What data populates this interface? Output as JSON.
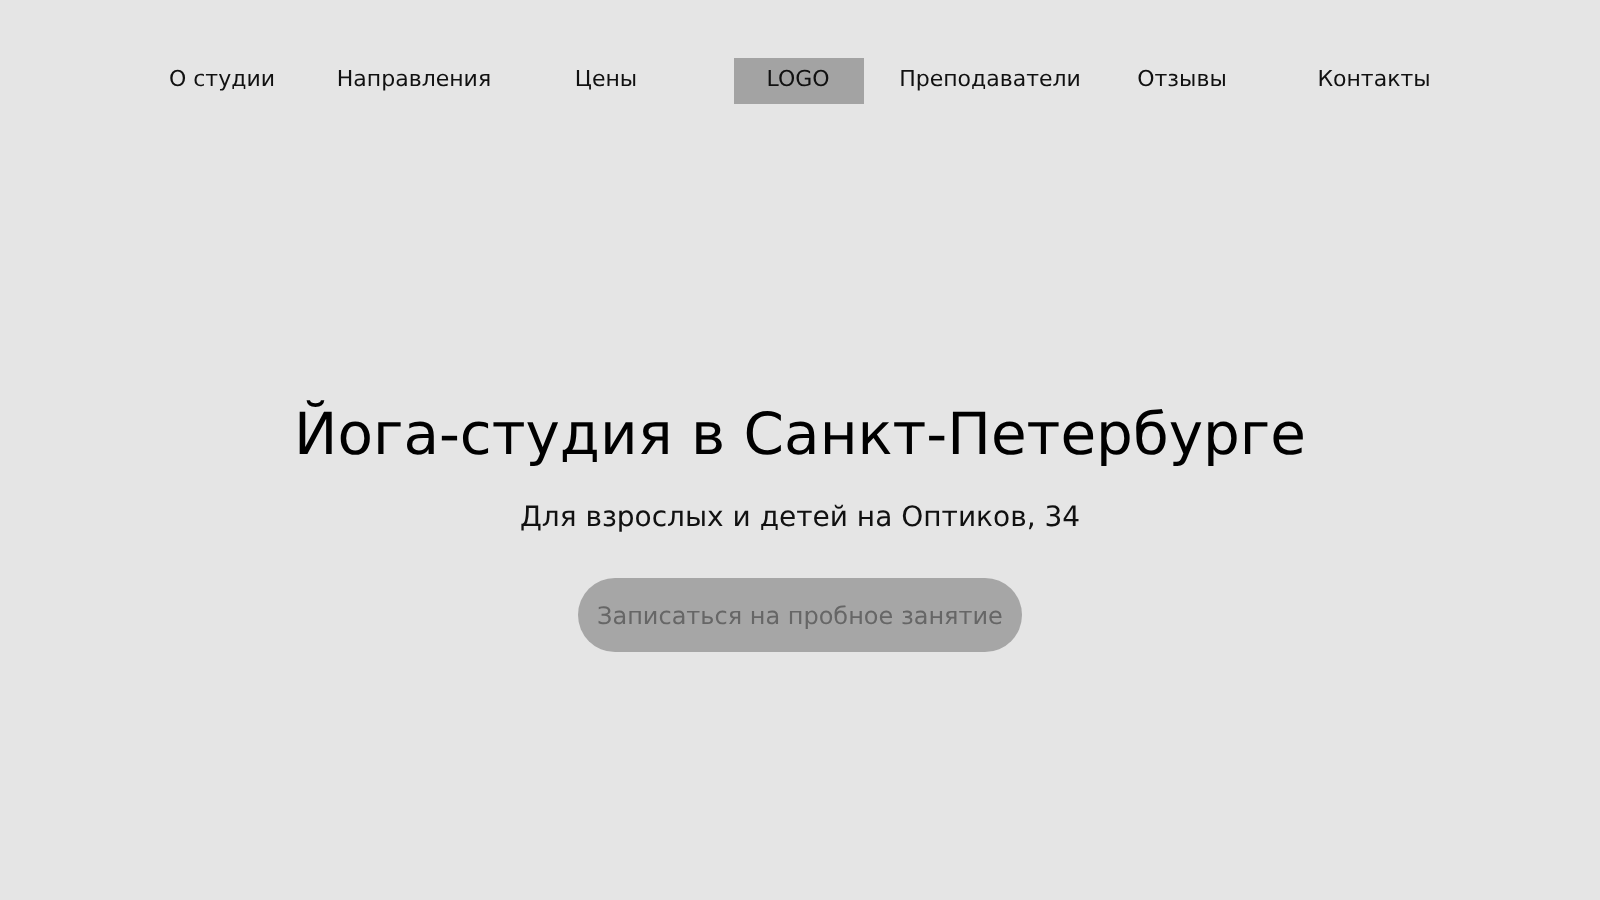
{
  "nav": [
    {
      "kind": "link",
      "label": "О студии"
    },
    {
      "kind": "link",
      "label": "Направления"
    },
    {
      "kind": "link",
      "label": "Цены"
    },
    {
      "kind": "logo",
      "label": "LOGO"
    },
    {
      "kind": "link",
      "label": "Преподаватели"
    },
    {
      "kind": "link",
      "label": "Отзывы"
    },
    {
      "kind": "link",
      "label": "Контакты"
    }
  ],
  "hero": {
    "title": "Йога-студия в Санкт-Петербурге",
    "subtitle": "Для взрослых и детей на Оптиков, 34",
    "button": "Записаться на пробное занятие"
  }
}
